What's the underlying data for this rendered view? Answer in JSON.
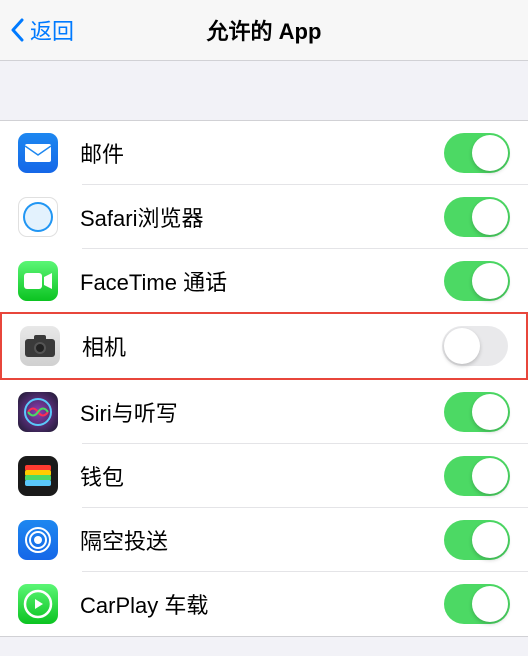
{
  "header": {
    "back_label": "返回",
    "title": "允许的 App"
  },
  "apps": [
    {
      "id": "mail",
      "label": "邮件",
      "enabled": true,
      "icon": "mail-icon",
      "highlighted": false
    },
    {
      "id": "safari",
      "label": "Safari浏览器",
      "enabled": true,
      "icon": "safari-icon",
      "highlighted": false
    },
    {
      "id": "facetime",
      "label": "FaceTime 通话",
      "enabled": true,
      "icon": "facetime-icon",
      "highlighted": false
    },
    {
      "id": "camera",
      "label": "相机",
      "enabled": false,
      "icon": "camera-icon",
      "highlighted": true
    },
    {
      "id": "siri",
      "label": "Siri与听写",
      "enabled": true,
      "icon": "siri-icon",
      "highlighted": false
    },
    {
      "id": "wallet",
      "label": "钱包",
      "enabled": true,
      "icon": "wallet-icon",
      "highlighted": false
    },
    {
      "id": "airdrop",
      "label": "隔空投送",
      "enabled": true,
      "icon": "airdrop-icon",
      "highlighted": false
    },
    {
      "id": "carplay",
      "label": "CarPlay 车载",
      "enabled": true,
      "icon": "carplay-icon",
      "highlighted": false
    }
  ]
}
